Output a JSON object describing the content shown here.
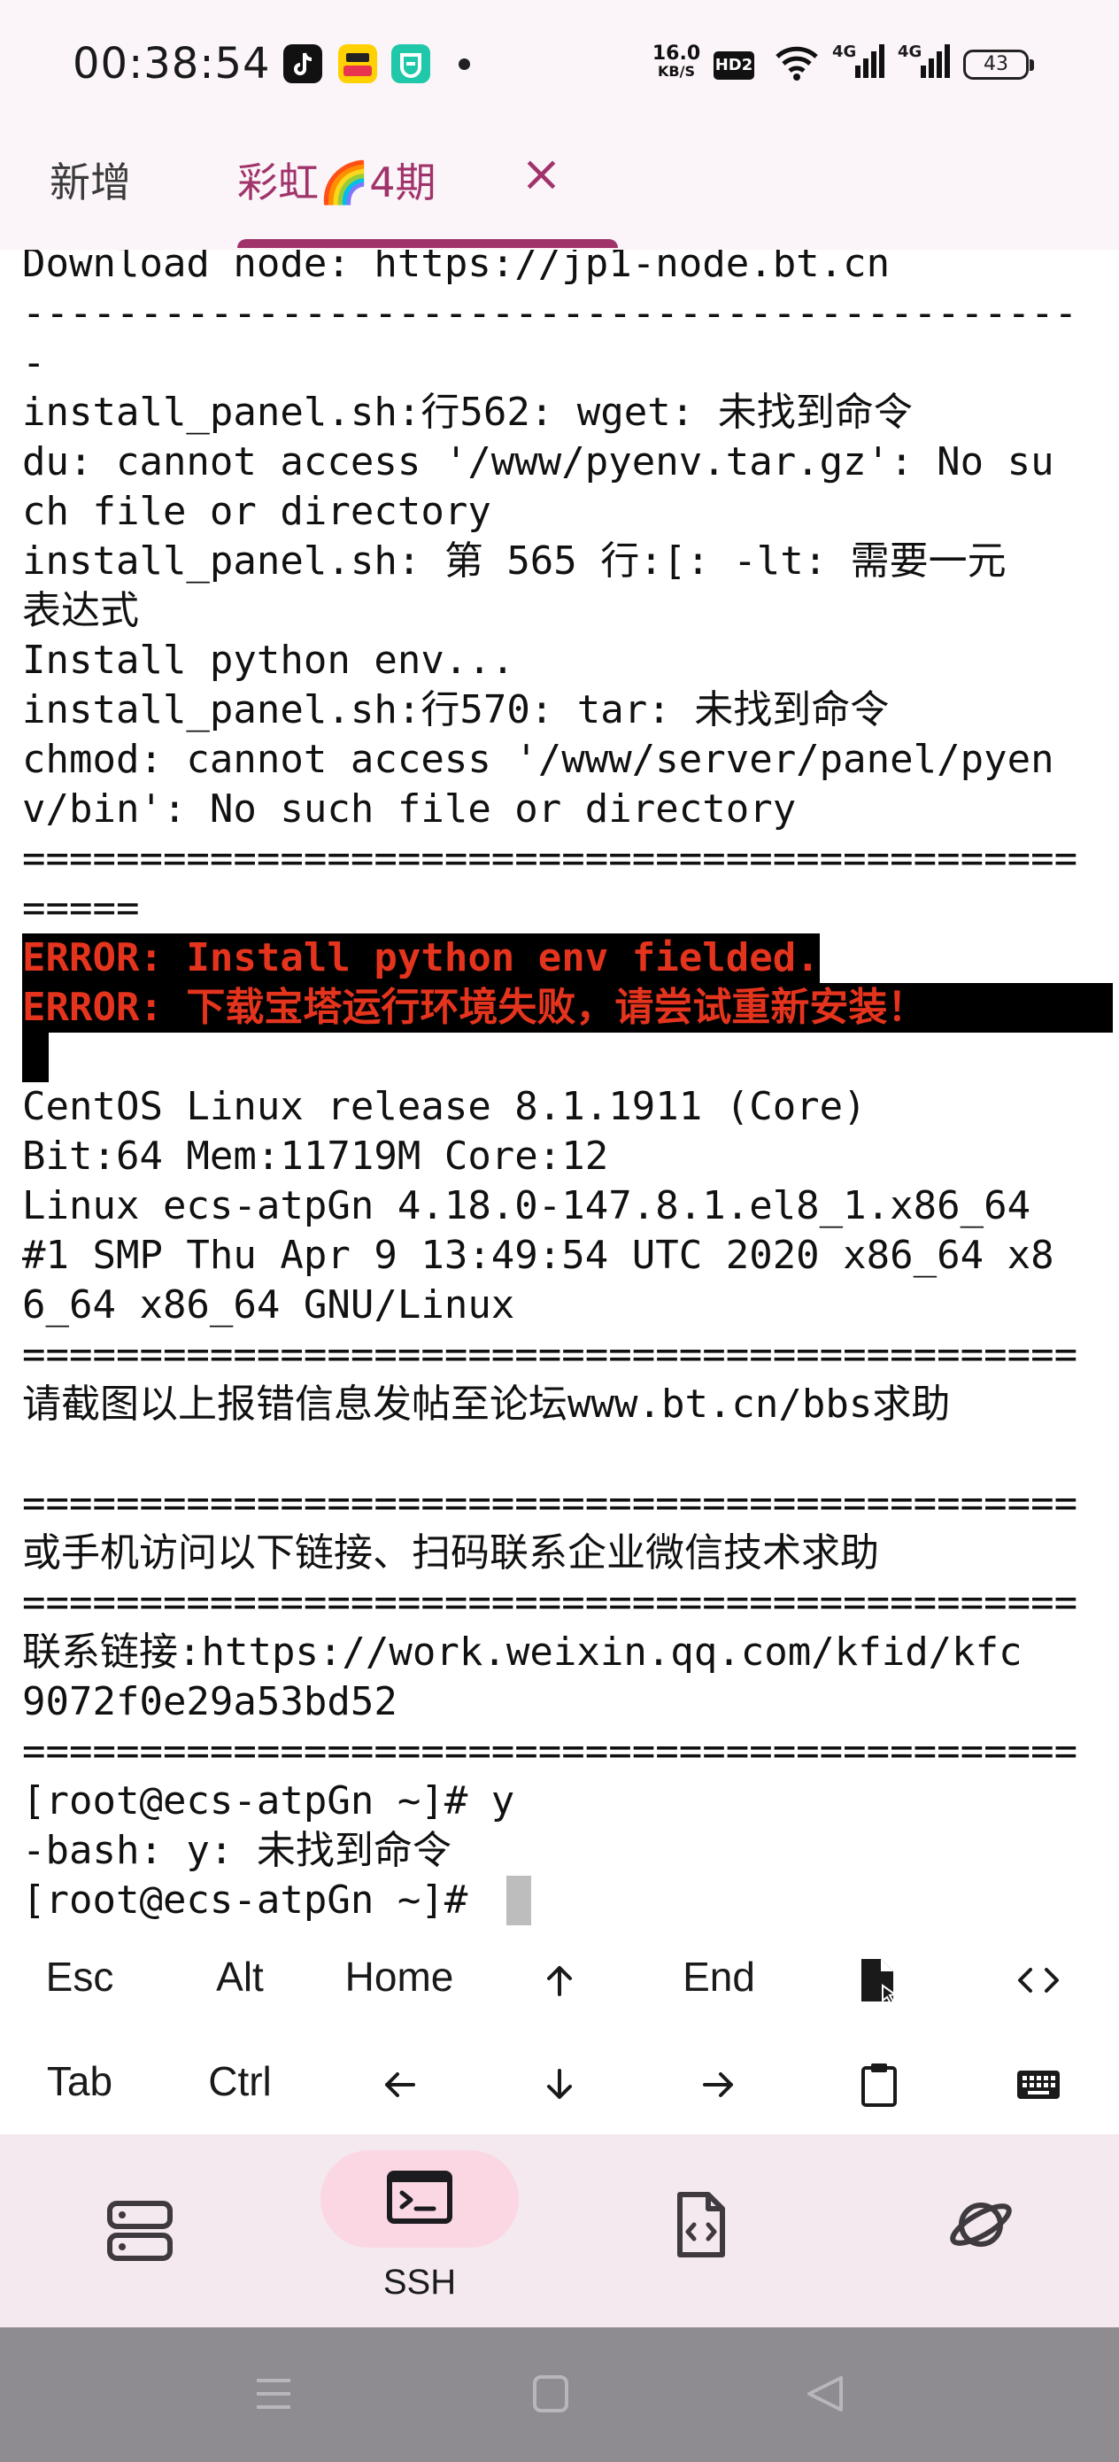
{
  "status_bar": {
    "time": "00:38:54",
    "speed_value": "16.0",
    "speed_unit": "KB/S",
    "hd_label": "HD2",
    "signal_1": "4G",
    "signal_2": "4G",
    "battery": "43",
    "app_icons": [
      "tiktok-icon",
      "meituan-icon",
      "mi-home-icon"
    ]
  },
  "tabs": {
    "new_label": "新增",
    "active_label": "彩虹🌈4期",
    "close_glyph": "×"
  },
  "terminal": {
    "lines": [
      "Download node: https://jp1-node.bt.cn",
      "---------------------------------------------",
      "-",
      "install_panel.sh:行562: wget: 未找到命令",
      "du: cannot access '/www/pyenv.tar.gz': No su",
      "ch file or directory",
      "install_panel.sh: 第 565 行:[: -lt: 需要一元",
      "表达式",
      "Install python env...",
      "install_panel.sh:行570: tar: 未找到命令",
      "chmod: cannot access '/www/server/panel/pyen",
      "v/bin': No such file or directory",
      "=============================================",
      "=====",
      "ERROR: Install python env fielded.",
      "ERROR: 下载宝塔运行环境失败，请尝试重新安装！",
      "",
      "CentOS Linux release 8.1.1911 (Core)",
      "Bit:64 Mem:11719M Core:12",
      "Linux ecs-atpGn 4.18.0-147.8.1.el8_1.x86_64",
      "#1 SMP Thu Apr 9 13:49:54 UTC 2020 x86_64 x8",
      "6_64 x86_64 GNU/Linux",
      "=============================================",
      "请截图以上报错信息发帖至论坛www.bt.cn/bbs求助",
      "",
      "=============================================",
      "或手机访问以下链接、扫码联系企业微信技术求助",
      "=============================================",
      "联系链接:https://work.weixin.qq.com/kfid/kfc",
      "9072f0e29a53bd52",
      "=============================================",
      "[root@ecs-atpGn ~]# y",
      "-bash: y: 未找到命令",
      "[root@ecs-atpGn ~]# "
    ]
  },
  "extra_keys": {
    "row1": [
      "Esc",
      "Alt",
      "Home",
      "↑",
      "End",
      "file-upload-icon",
      "code-icon"
    ],
    "row2": [
      "Tab",
      "Ctrl",
      "←",
      "↓",
      "→",
      "clipboard-icon",
      "keyboard-icon"
    ]
  },
  "bottom_nav": {
    "ssh_label": "SSH"
  },
  "colors": {
    "accent": "#a0336a",
    "error_text": "#e5341d",
    "nav_background": "#f3e9ee",
    "nav_active_pill": "#fbd7e3",
    "system_nav": "#8e8b91"
  }
}
